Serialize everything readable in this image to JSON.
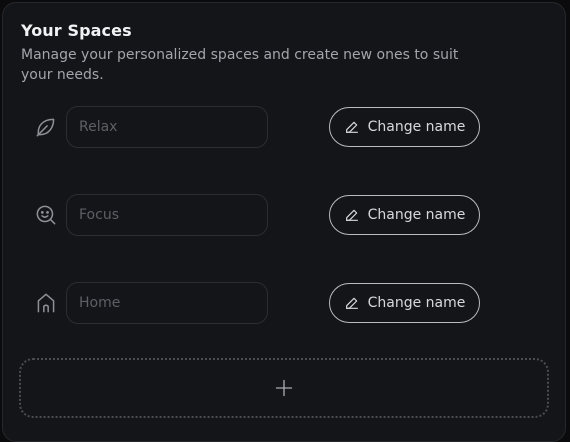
{
  "header": {
    "title": "Your Spaces",
    "subtitle": "Manage your personalized spaces and create new ones to suit your needs."
  },
  "spaces": [
    {
      "icon": "leaf-icon",
      "placeholder": "Relax",
      "button_label": "Change name"
    },
    {
      "icon": "face-search-icon",
      "placeholder": "Focus",
      "button_label": "Change name"
    },
    {
      "icon": "home-icon",
      "placeholder": "Home",
      "button_label": "Change name"
    }
  ],
  "add_space": {
    "icon": "plus-icon"
  },
  "colors": {
    "panel_background": "#141518",
    "border": "#2c2d31",
    "text_primary": "#f2f2f4",
    "text_secondary": "#a3a5ab",
    "placeholder": "#5d5f65",
    "button_border": "#b9bbc0"
  }
}
